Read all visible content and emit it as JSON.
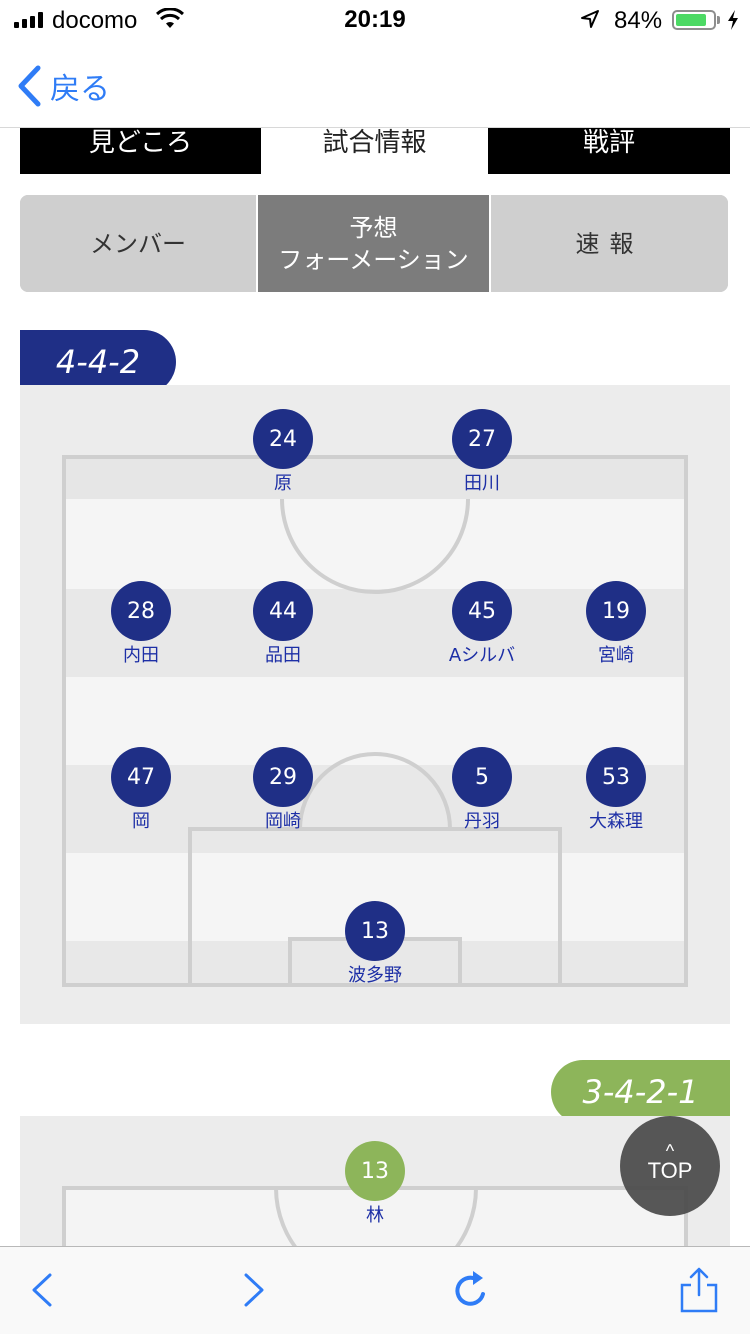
{
  "status_bar": {
    "carrier": "docomo",
    "time": "20:19",
    "battery_percent": "84%",
    "battery_level": 0.84
  },
  "nav": {
    "back_label": "戻る"
  },
  "top_tabs": [
    {
      "label": "見どころ"
    },
    {
      "label": "試合情報"
    },
    {
      "label": "戦評"
    }
  ],
  "sub_tabs": {
    "members": "メンバー",
    "formation_line1": "予想",
    "formation_line2": "フォーメーション",
    "live": "速報"
  },
  "formation1": {
    "label": "4-4-2",
    "players": [
      {
        "number": "24",
        "name": "原"
      },
      {
        "number": "27",
        "name": "田川"
      },
      {
        "number": "28",
        "name": "内田"
      },
      {
        "number": "44",
        "name": "品田"
      },
      {
        "number": "45",
        "name": "Aシルバ"
      },
      {
        "number": "19",
        "name": "宮崎"
      },
      {
        "number": "47",
        "name": "岡"
      },
      {
        "number": "29",
        "name": "岡崎"
      },
      {
        "number": "5",
        "name": "丹羽"
      },
      {
        "number": "53",
        "name": "大森理"
      },
      {
        "number": "13",
        "name": "波多野"
      }
    ]
  },
  "formation2": {
    "label": "3-4-2-1",
    "players": [
      {
        "number": "13",
        "name": "林"
      }
    ]
  },
  "top_button": {
    "label": "TOP"
  },
  "colors": {
    "accent_blue": "#2f7cf6",
    "navy": "#1f2f86",
    "green": "#8db55a",
    "player_name": "#1d2fa6"
  }
}
